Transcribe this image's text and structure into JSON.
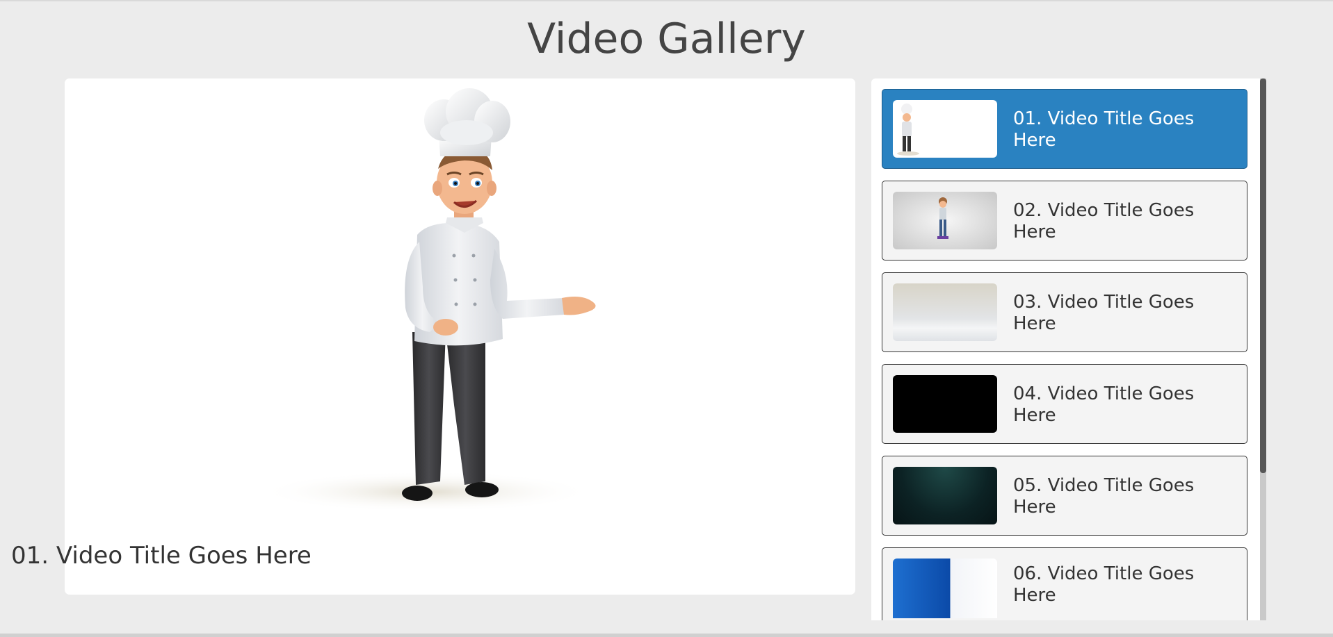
{
  "page": {
    "title": "Video Gallery"
  },
  "player": {
    "current_title": "01. Video Title Goes Here"
  },
  "playlist": {
    "items": [
      {
        "label": "01. Video Title Goes Here",
        "thumbnail": "chef-walking-thumbnail",
        "active": true
      },
      {
        "label": "02. Video Title Goes Here",
        "thumbnail": "boy-walking-thumbnail",
        "active": false
      },
      {
        "label": "03. Video Title Goes Here",
        "thumbnail": "blurred-room-thumbnail",
        "active": false
      },
      {
        "label": "04. Video Title Goes Here",
        "thumbnail": "black-screen-thumbnail",
        "active": false
      },
      {
        "label": "05. Video Title Goes Here",
        "thumbnail": "dark-teal-light-thumbnail",
        "active": false
      },
      {
        "label": "06. Video Title Goes Here",
        "thumbnail": "blue-panel-thumbnail",
        "active": false
      }
    ]
  },
  "colors": {
    "background": "#ececec",
    "active_item": "#2a82c1",
    "item_border": "#333333",
    "title_text": "#444444"
  }
}
